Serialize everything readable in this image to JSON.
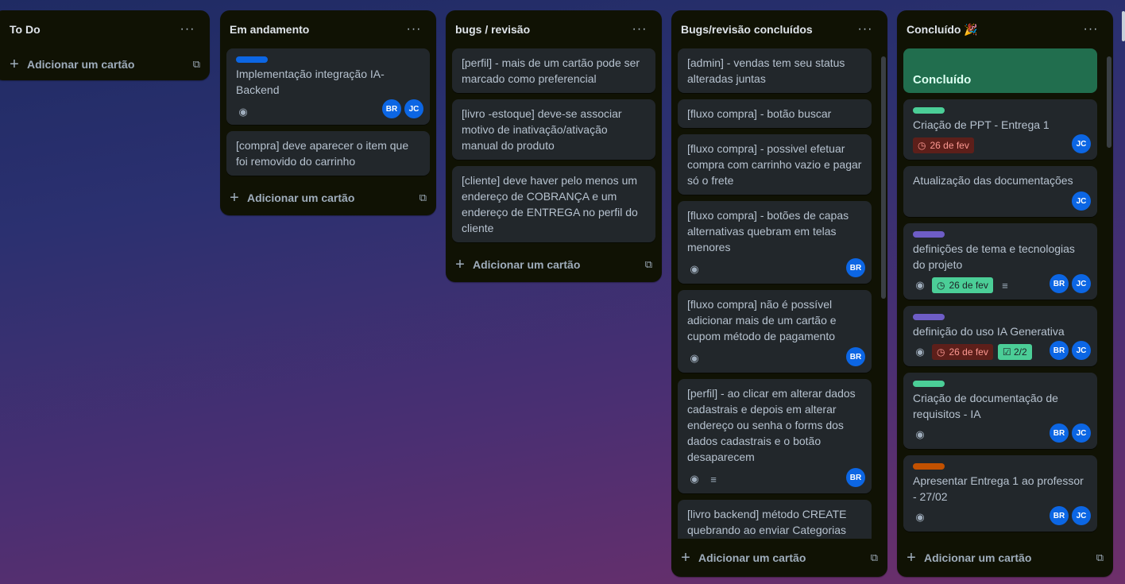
{
  "colors": {
    "label_blue": "#0c66e4",
    "label_green": "#4bce97",
    "label_purple": "#6e5dc6",
    "label_orange": "#c25100",
    "avatar": "#0c66e4"
  },
  "common": {
    "menu_icon": "more-horizontal-icon",
    "add_label": "Adicionar um cartão",
    "template_icon": "card-template-icon",
    "dots": "···"
  },
  "lists": [
    {
      "title": "To Do"
    },
    {
      "title": "Em andamento",
      "cards": [
        {
          "title": "Implementação integração IA-Backend",
          "members": [
            "BR",
            "JC"
          ]
        },
        {
          "title": "[compra] deve aparecer o item que foi removido do carrinho"
        }
      ]
    },
    {
      "title": "bugs / revisão",
      "cards": [
        {
          "title": "[perfil] - mais de um cartão pode ser marcado como preferencial"
        },
        {
          "title": "[livro -estoque] deve-se associar motivo de inativação/ativação manual do produto"
        },
        {
          "title": "[cliente] deve haver pelo menos um endereço de COBRANÇA e um endereço de ENTREGA no perfil do cliente"
        }
      ]
    },
    {
      "title": "Bugs/revisão concluídos",
      "cards": [
        {
          "title": "[admin] - vendas tem seu status alteradas juntas"
        },
        {
          "title": "[fluxo compra] - botão buscar"
        },
        {
          "title": "[fluxo compra] - possivel efetuar compra com carrinho vazio e pagar só o frete"
        },
        {
          "title": "[fluxo compra] - botões de capas alternativas quebram em telas menores",
          "members": [
            "BR"
          ]
        },
        {
          "title": "[fluxo compra] não é possível adicionar mais de um cartão e cupom método de pagamento",
          "members": [
            "BR"
          ]
        },
        {
          "title": "[perfil] - ao clicar em alterar dados cadastrais e depois em alterar endereço ou senha o forms dos dados cadastrais e o botão desaparecem",
          "members": [
            "BR"
          ]
        },
        {
          "title": "[livro backend] método CREATE quebrando ao enviar Categorias"
        }
      ]
    },
    {
      "title": "Concluído 🎉",
      "cover_card": "Concluído",
      "cards": [
        {
          "title": "Criação de PPT - Entrega 1",
          "date": "26 de fev",
          "members": [
            "JC"
          ]
        },
        {
          "title": "Atualização das documentações",
          "members": [
            "JC"
          ]
        },
        {
          "title": "definições de tema e tecnologias do projeto",
          "date": "26 de fev",
          "members": [
            "BR",
            "JC"
          ]
        },
        {
          "title": "definição do uso IA Generativa",
          "date": "26 de fev",
          "checklist": "2/2",
          "members": [
            "BR",
            "JC"
          ]
        },
        {
          "title": "Criação de documentação de requisitos - IA",
          "members": [
            "BR",
            "JC"
          ]
        },
        {
          "title": "Apresentar Entrega 1 ao professor - 27/02",
          "members": [
            "BR",
            "JC"
          ]
        }
      ]
    }
  ]
}
